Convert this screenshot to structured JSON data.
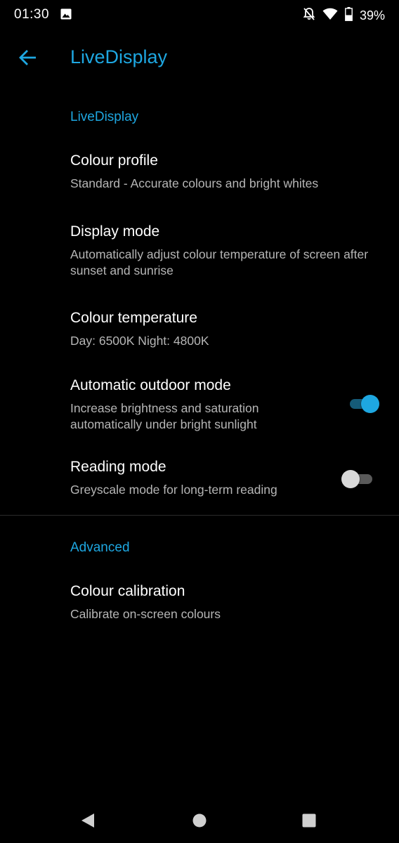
{
  "status_bar": {
    "time": "01:30",
    "battery": "39%",
    "icons": [
      "gallery-icon",
      "notifications-off-icon",
      "wifi-icon",
      "battery-icon"
    ]
  },
  "header": {
    "title": "LiveDisplay",
    "back_icon": "back-arrow-icon"
  },
  "sections": [
    {
      "title": "LiveDisplay",
      "items": [
        {
          "title": "Colour profile",
          "summary": "Standard - Accurate colours and bright whites"
        },
        {
          "title": "Display mode",
          "summary": "Automatically adjust colour temperature of screen after sunset and sunrise"
        },
        {
          "title": "Colour temperature",
          "summary": "Day: 6500K Night: 4800K"
        },
        {
          "title": "Automatic outdoor mode",
          "summary": "Increase brightness and saturation automatically under bright sunlight",
          "switch_on": true
        },
        {
          "title": "Reading mode",
          "summary": "Greyscale mode for long-term reading",
          "switch_on": false
        }
      ]
    },
    {
      "title": "Advanced",
      "items": [
        {
          "title": "Colour calibration",
          "summary": "Calibrate on-screen colours"
        }
      ]
    }
  ],
  "nav_bar": {
    "icons": [
      "back-triangle-icon",
      "home-circle-icon",
      "recents-square-icon"
    ]
  },
  "colors": {
    "background": "#000000",
    "accent": "#1ea7e1",
    "title_text": "#ffffff",
    "summary_text": "#b6b6b6",
    "switch_on_track": "#155b78",
    "switch_off_track": "#5a5a5a",
    "switch_off_thumb": "#d9d9d9"
  }
}
